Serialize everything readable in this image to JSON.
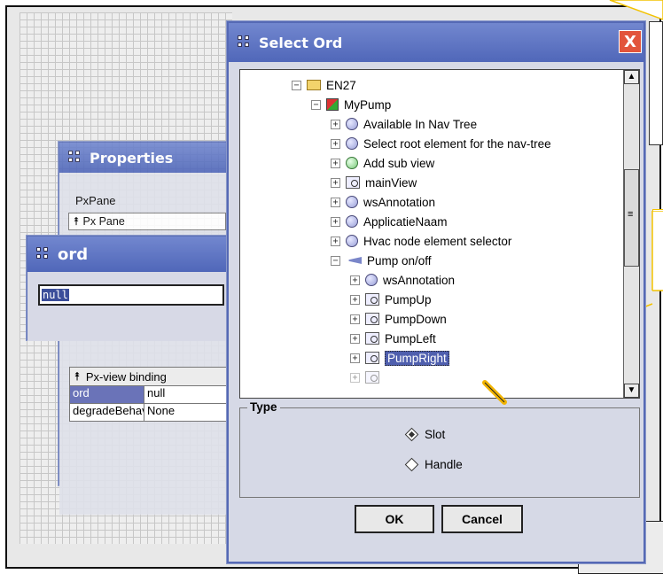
{
  "properties": {
    "title": "Properties",
    "pane_label": "PxPane",
    "pane_row": "Px Pane"
  },
  "ord_window": {
    "title": "ord",
    "value": "null"
  },
  "binding": {
    "header": "Px-view binding",
    "rows": [
      {
        "key": "ord",
        "value": "null"
      },
      {
        "key": "degradeBehavi",
        "value": "None"
      }
    ]
  },
  "dialog": {
    "title": "Select Ord",
    "close": "X",
    "tree": [
      {
        "label": "EN27",
        "toggle": "−"
      },
      {
        "label": "MyPump",
        "toggle": "−"
      },
      {
        "label": "Available In Nav Tree",
        "toggle": "+"
      },
      {
        "label": "Select root element for the nav-tree",
        "toggle": "+"
      },
      {
        "label": "Add sub view",
        "toggle": "+"
      },
      {
        "label": "mainView",
        "toggle": "+"
      },
      {
        "label": "wsAnnotation",
        "toggle": "+"
      },
      {
        "label": "ApplicatieNaam",
        "toggle": "+"
      },
      {
        "label": "Hvac node element selector",
        "toggle": "+"
      },
      {
        "label": "Pump on/off",
        "toggle": "−"
      },
      {
        "label": "wsAnnotation",
        "toggle": "+"
      },
      {
        "label": "PumpUp",
        "toggle": "+"
      },
      {
        "label": "PumpDown",
        "toggle": "+"
      },
      {
        "label": "PumpLeft",
        "toggle": "+"
      },
      {
        "label": "PumpRight",
        "toggle": "+"
      }
    ],
    "type_legend": "Type",
    "radio_slot": "Slot",
    "radio_handle": "Handle",
    "ok": "OK",
    "cancel": "Cancel",
    "scroll_grip": "≡"
  },
  "colors": {
    "accent": "#5067b9",
    "callout": "#f3c200"
  }
}
